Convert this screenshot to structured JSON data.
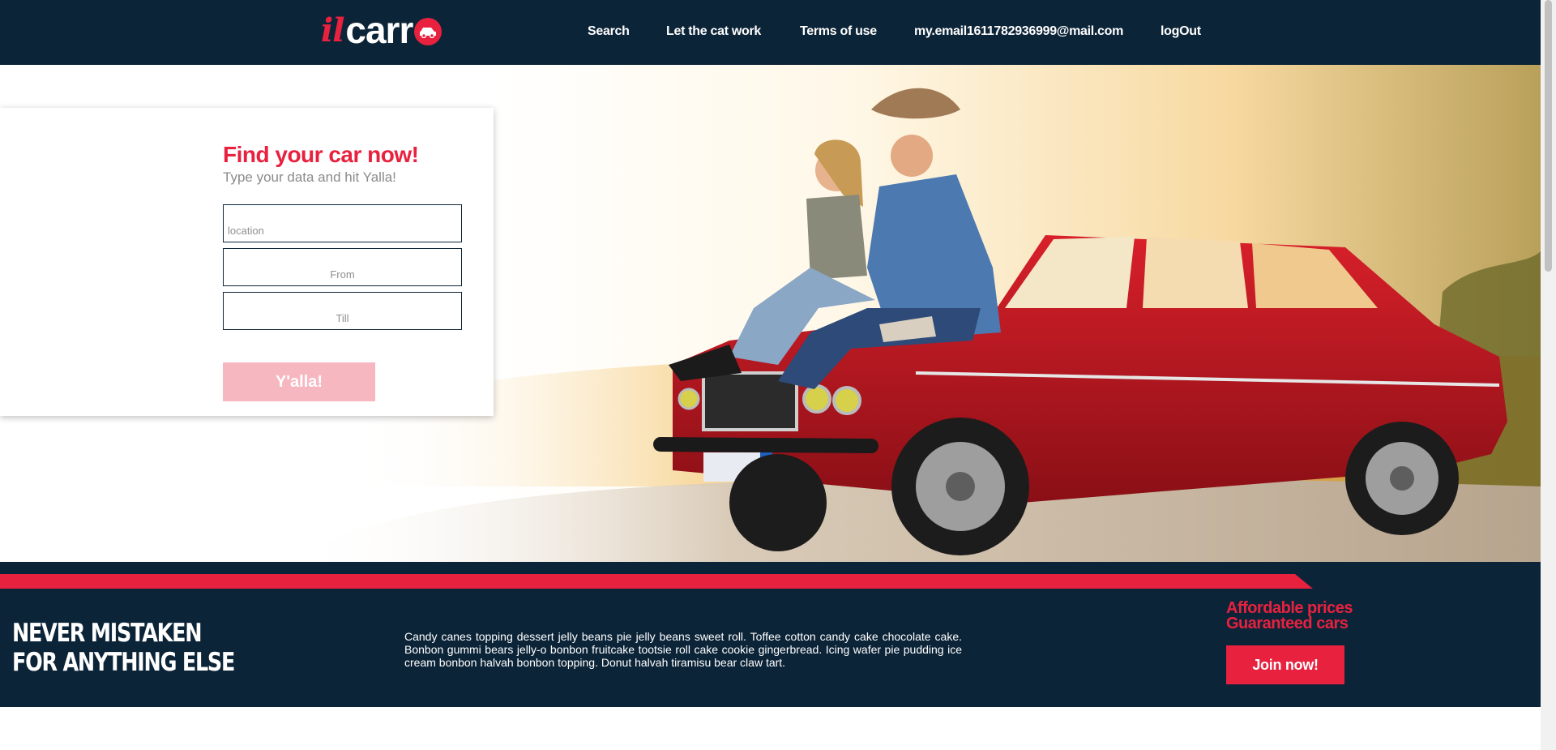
{
  "header": {
    "logo": {
      "il": "il",
      "carro": "carr"
    },
    "nav": [
      {
        "label": "Search"
      },
      {
        "label": "Let the cat work"
      },
      {
        "label": "Terms of use"
      },
      {
        "label": "my.email1611782936999@mail.com"
      },
      {
        "label": "logOut"
      }
    ]
  },
  "search": {
    "title": "Find your car now!",
    "subtitle": "Type your data and hit Yalla!",
    "location_placeholder": "location",
    "from_placeholder": "From",
    "till_placeholder": "Till",
    "submit_label": "Y'alla!"
  },
  "banner": {
    "headline_line1": "NEVER MISTAKEN",
    "headline_line2": "FOR ANYTHING ELSE",
    "body": "Candy canes topping dessert jelly beans pie jelly beans sweet roll. Toffee cotton candy cake chocolate cake. Bonbon gummi bears jelly-o bonbon fruitcake tootsie roll cake cookie gingerbread. Icing wafer pie pudding ice cream bonbon halvah bonbon topping. Donut halvah tiramisu bear claw tart.",
    "promo_line1": "Affordable prices",
    "promo_line2": "Guaranteed cars",
    "join_label": "Join now!"
  },
  "colors": {
    "navy": "#0c2438",
    "accent_red": "#e8213f",
    "disabled_pink": "#f6b7c1"
  },
  "icons": [
    "car-badge-icon"
  ]
}
